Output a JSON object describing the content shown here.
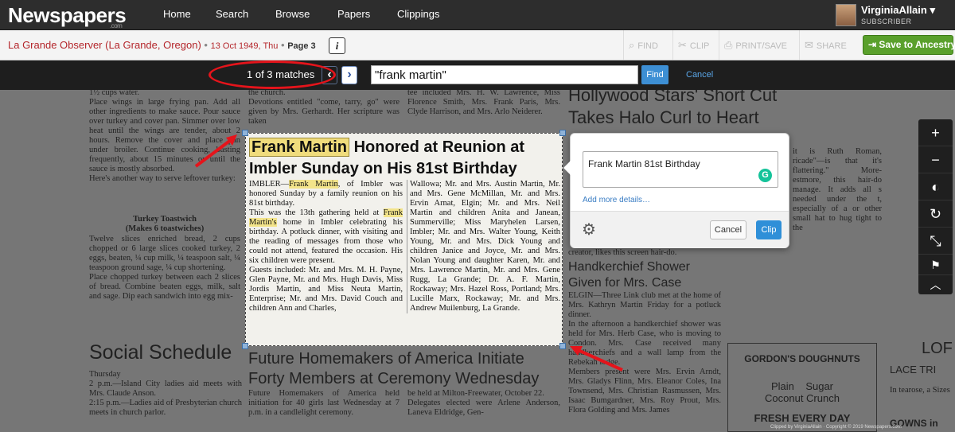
{
  "nav": {
    "logo_main": "Newspapers",
    "logo_sub": ".com",
    "links": [
      "Home",
      "Search",
      "Browse",
      "Papers",
      "Clippings"
    ],
    "user_name": "VirginiaAllain",
    "user_role": "SUBSCRIBER"
  },
  "titlebar": {
    "publication": "La Grande Observer (La Grande, Oregon)",
    "date": "13 Oct 1949, Thu",
    "page": "Page 3",
    "info": "i",
    "tools": [
      "FIND",
      "CLIP",
      "PRINT/SAVE",
      "SHARE"
    ],
    "ancestry": "Save to Ancestry"
  },
  "search": {
    "matches": "1 of 3 matches",
    "query": "\"frank martin\"",
    "find": "Find",
    "cancel": "Cancel"
  },
  "popup": {
    "clip_title": "Frank Martin 81st Birthday",
    "more_details": "Add more details…",
    "cancel": "Cancel",
    "clip": "Clip"
  },
  "article": {
    "headline_hl": "Frank Martin",
    "headline_rest": "Honored at Reunion at",
    "headline2": "Imbler Sunday on His 81st Birthday",
    "col1_a": "IMBLER—",
    "col1_hl1": "Frank Martin",
    "col1_b": ", of Imbler was honored Sunday by a family reunion on his 81st birthday.",
    "col1_c": "This was the 13th gathering held at",
    "col1_hl2": "Frank Martin's",
    "col1_d": "home in Imbler celebrating his birthday. A potluck dinner, with visiting and the reading of messages from those who could not attend, featured the occasion. His six children were present.",
    "col1_e": "Guests included: Mr. and Mrs. M. H. Payne, Glen Payne, Mr. and Mrs. Hugh Davis, Miss Jordis Martin, and Miss Neuta Martin, Enterprise; Mr. and Mrs. David Couch and children Ann and Charles,",
    "col2": "Wallowa; Mr. and Mrs. Austin Martin, Mr. and Mrs. Gene McMillan, Mr. and Mrs. Ervin Arnat, Elgin; Mr. and Mrs. Neil Martin and children Anita and Janean, Summerville; Miss Maryhelen Larsen, Imbler; Mr. and Mrs. Walter Young, Keith Young, Mr. and Mrs. Dick Young and children Janice and Joyce, Mr. and Mrs. Nolan Young and daughter Karen, Mr. and Mrs. Lawrence Martin, Mr. and Mrs. Gene Rugg, La Grande; Dr. A. F. Martin, Rockaway; Mrs. Hazel Ross, Portland; Mrs. Lucille Marx, Rockaway; Mr. and Mrs. Andrew Muilenburg, La Grande."
  },
  "background": {
    "left_col_top": "1½ cups water.\nPlace wings in large frying pan. Add all other ingredients to make sauce. Pour sauce over turkey and cover pan. Simmer over low heat until the wings are tender, about 2 hours. Remove the cover and place pan under broiler. Continue cooking, basting frequently, about 15 minutes or until the sauce is mostly absorbed.\nHere's another way to serve leftover turkey:",
    "toastwich_title": "Turkey Toastwich",
    "toastwich_sub": "(Makes 6 toastwiches)",
    "toastwich_body": "Twelve slices enriched bread, 2 cups chopped or 6 large slices cooked turkey, 2 eggs, beaten, ¼ cup milk, ¼ teaspoon salt, ¼ teaspoon ground sage, ¼ cup shortening.\nPlace chopped turkey between each 2 slices of bread. Combine beaten eggs, milk, salt and sage. Dip each sandwich into egg mix-",
    "social": "Social Schedule",
    "social_body": "Thursday\n2 p.m.—Island City ladies aid meets with Mrs. Claude Anson.\n2:15 p.m.—Ladies aid of Presbyterian church meets in church parlor.",
    "mid_top": "the church.\nDevotions entitled \"come, tarry, go\" were given by Mrs. Gerhardt. Her scripture was taken",
    "mid_top2": "tee included Mrs. H. W. Lawrence, Miss Florence Smith, Mrs. Frank Paris, Mrs. Clyde Harrison, and Mrs. Arlo Neiderer.",
    "future": "Future Homemakers of America Initiate",
    "forty": "Forty Members at Ceremony Wednesday",
    "future_body1": "Future Homemakers of America held initiation for 40 girls last Wednesday at 7 p.m. in a candlelight ceremony.",
    "future_body2": "be held at Milton-Freewater, October 22.\nDelegates elected were Arlene Anderson, Laneva Eldridge, Gen-",
    "hollywood1": "Hollywood Stars' Short Cut",
    "hollywood2": "Takes Halo Curl to Heart",
    "right_frag": "it is Ruth Roman, ricade\"—is that it's flattering.\" More- estmore, this hair-do manage. It adds all s needed under the t, especially of a or other small hat to hug tight to the",
    "creator": "creator, likes this screen hair-do.",
    "hanky1": "Handkerchief Shower",
    "hanky2": "Given for Mrs. Case",
    "hanky_body": "ELGIN—Three Link club met at the home of Mrs. Kathryn Martin Friday for a potluck dinner.\nIn the afternoon a handkerchief shower was held for Mrs. Herb Case, who is moving to Condon. Mrs. Case received many handkerchiefs and a wall lamp from the Rebekah lodge.\nMembers present were Mrs. Ervin Arndt, Mrs. Gladys Flinn, Mrs. Eleanor Coles, Ina Townsend, Mrs. Christian Rasmussen, Mrs. Isaac Bumgardner, Mrs. Roy Prout, Mrs. Flora Golding and Mrs. James",
    "ad1": "GORDON'S DOUGHNUTS",
    "ad2": "Plain    Sugar",
    "ad3": "Coconut Crunch",
    "ad4": "FRESH EVERY DAY",
    "far_right1": "LOF",
    "far_right2": "LACE TRI",
    "far_right3": "In tearose, a Sizes",
    "far_right4": "GOWNS in",
    "footer": "Clipped by VirginiaAllain · Copyright © 2019 Newspapers.com"
  },
  "sidetools": [
    "zoom-in",
    "zoom-out",
    "contrast",
    "rotate",
    "fullscreen",
    "flag",
    "collapse"
  ]
}
